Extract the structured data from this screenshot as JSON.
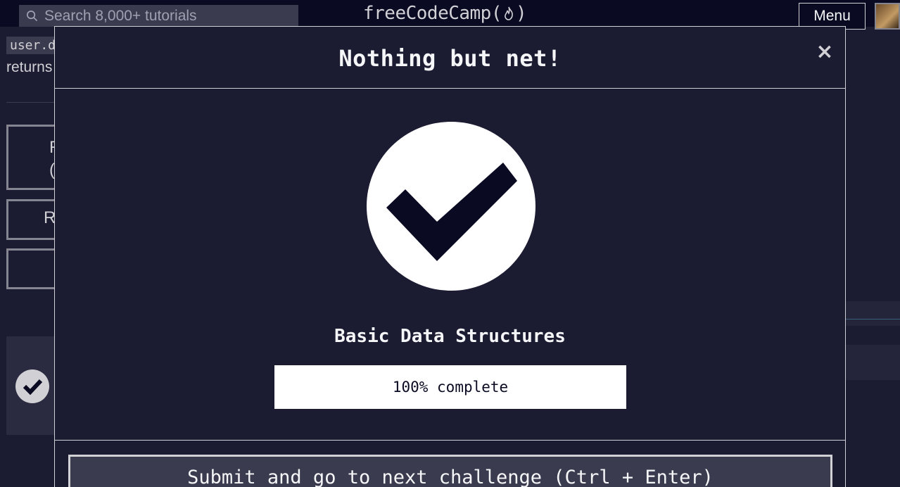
{
  "nav": {
    "search_placeholder": "Search 8,000+ tutorials",
    "logo_text_pre": "freeCodeCamp(",
    "logo_text_post": ")",
    "menu_label": "Menu"
  },
  "background": {
    "code_snippet": "user.d",
    "returns_text": "returns",
    "btn1_label_line1": "R",
    "btn1_label_line2": "(",
    "btn2_label": "R"
  },
  "modal": {
    "title": "Nothing but net!",
    "close_label": "×",
    "cert_title": "Basic Data Structures",
    "progress_text": "100% complete",
    "progress_percent": 100,
    "submit_label": "Submit and go to next challenge (Ctrl + Enter)"
  },
  "colors": {
    "page_bg": "#0a0a23",
    "modal_bg": "#1b1b32",
    "accent_text": "#f5f6f7",
    "check_bg": "#ffffff",
    "check_mark": "#0a0a23",
    "button_bg": "#3b3b4f"
  },
  "icons": {
    "search": "search-icon",
    "flame": "flame-icon",
    "close": "close-icon",
    "check": "checkmark-icon"
  }
}
